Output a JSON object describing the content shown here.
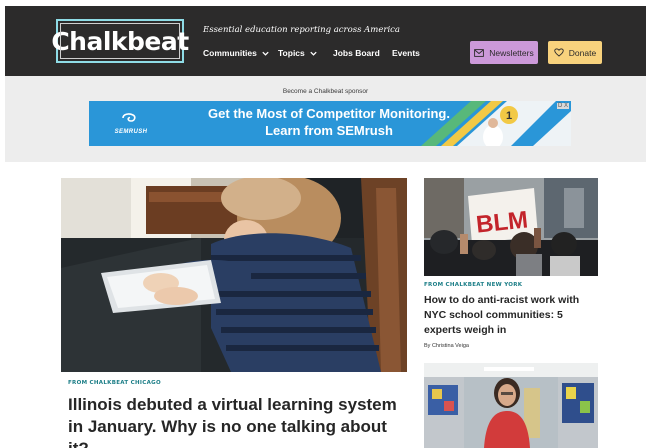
{
  "header": {
    "logo_text": "Chalkbeat",
    "tagline": "Essential education reporting across America",
    "nav": [
      {
        "label": "Communities",
        "has_dropdown": true,
        "icon": "chevron-down-icon"
      },
      {
        "label": "Topics",
        "has_dropdown": true,
        "icon": "chevron-down-icon"
      },
      {
        "label": "Jobs Board",
        "has_dropdown": false
      },
      {
        "label": "Events",
        "has_dropdown": false
      }
    ],
    "newsletters_button": {
      "label": "Newsletters",
      "icon": "envelope-icon",
      "color": "#cc99d9"
    },
    "donate_button": {
      "label": "Donate",
      "icon": "heart-icon",
      "color": "#f8d27d"
    },
    "background_color": "#2c2b2b"
  },
  "sponsor": {
    "label": "Become a Chalkbeat sponsor",
    "ad": {
      "brand": "SEMRUSH",
      "line1": "Get the Most of Competitor Monitoring.",
      "line2": "Learn from SEMrush",
      "close_label": "D X",
      "color": "#2a96d8"
    }
  },
  "main_story": {
    "kicker": "FROM CHALKBEAT CHICAGO",
    "headline": "Illinois debuted a virtual learning system in January. Why is no one talking about it?",
    "kicker_color": "#1a7d86"
  },
  "side_story": {
    "kicker": "FROM CHALKBEAT NEW YORK",
    "headline": "How to do anti-racist work with NYC school communities: 5 experts weigh in",
    "byline": "By Christina Veiga",
    "sign_text": "BLM"
  }
}
